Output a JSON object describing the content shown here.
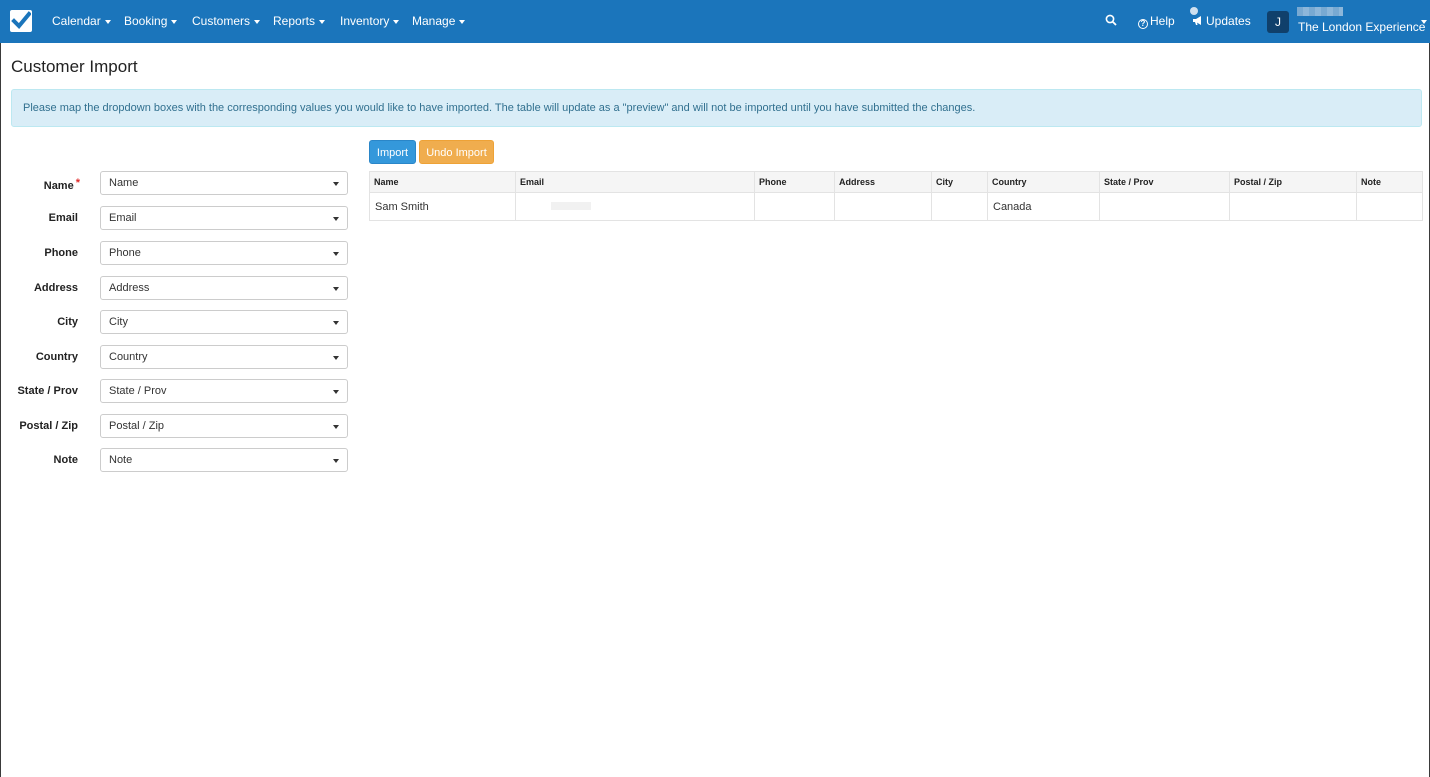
{
  "nav": {
    "items": [
      {
        "label": "Calendar"
      },
      {
        "label": "Booking"
      },
      {
        "label": "Customers"
      },
      {
        "label": "Reports"
      },
      {
        "label": "Inventory"
      },
      {
        "label": "Manage"
      }
    ],
    "help_label": "Help",
    "updates_label": "Updates",
    "avatar_initial": "J",
    "account_name": "The London Experience"
  },
  "page": {
    "title": "Customer Import",
    "info_message": "Please map the dropdown boxes with the corresponding values you would like to have imported. The table will update as a \"preview\" and will not be imported until you have submitted the changes."
  },
  "form": {
    "fields": [
      {
        "label": "Name",
        "required": "*",
        "value": "Name"
      },
      {
        "label": "Email",
        "value": "Email"
      },
      {
        "label": "Phone",
        "value": "Phone"
      },
      {
        "label": "Address",
        "value": "Address"
      },
      {
        "label": "City",
        "value": "City"
      },
      {
        "label": "Country",
        "value": "Country"
      },
      {
        "label": "State / Prov",
        "value": "State / Prov"
      },
      {
        "label": "Postal / Zip",
        "value": "Postal / Zip"
      },
      {
        "label": "Note",
        "value": "Note"
      }
    ]
  },
  "actions": {
    "import_label": "Import",
    "undo_label": "Undo Import"
  },
  "preview_table": {
    "columns": [
      "Name",
      "Email",
      "Phone",
      "Address",
      "City",
      "Country",
      "State / Prov",
      "Postal / Zip",
      "Note"
    ],
    "rows": [
      [
        "Sam Smith",
        "",
        "",
        "",
        "",
        "Canada",
        "",
        "",
        ""
      ]
    ]
  },
  "colors": {
    "navbar": "#1b75bb",
    "import_button": "#3498db",
    "undo_button": "#f0ad4e",
    "info_bg": "#d9edf7",
    "required": "#e02b2b"
  }
}
